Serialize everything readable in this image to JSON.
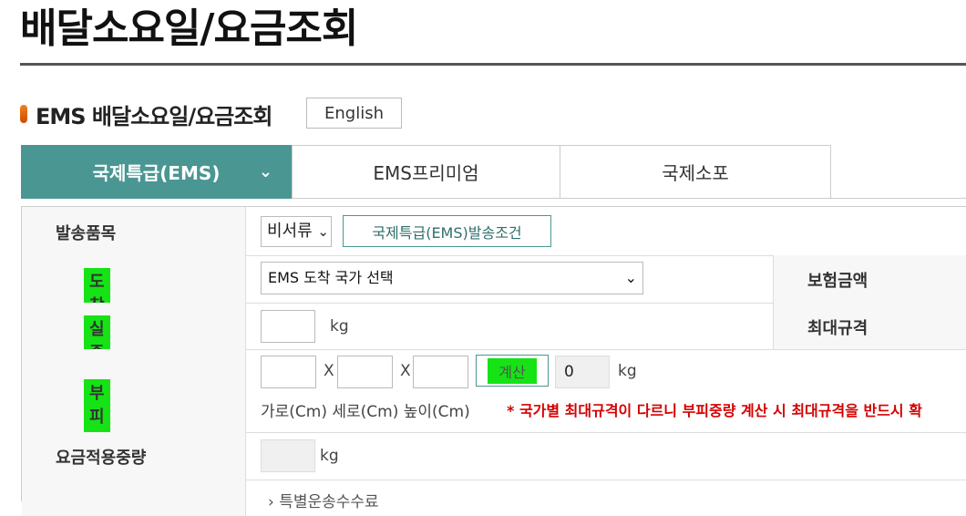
{
  "page": {
    "title": "배달소요일/요금조회"
  },
  "section": {
    "title": "EMS 배달소요일/요금조회",
    "english_button": "English"
  },
  "tabs": [
    {
      "label": "국제특급(EMS)",
      "active": true
    },
    {
      "label": "EMS프리미엄",
      "active": false
    },
    {
      "label": "국제소포",
      "active": false
    }
  ],
  "form": {
    "item_type": {
      "label": "발송품목",
      "selected": "비서류",
      "condition_button": "국제특급(EMS)발송조건"
    },
    "destination": {
      "label": "도착지",
      "selected": "EMS 도착 국가 선택"
    },
    "insurance": {
      "label": "보험금액"
    },
    "actual_weight": {
      "label": "실중량",
      "value": "",
      "unit": "kg"
    },
    "max_size": {
      "label": "최대규격"
    },
    "volume_weight": {
      "label": "부피중량",
      "width": "",
      "depth": "",
      "height": "",
      "separator": "X",
      "calc_button": "계산",
      "result": "0",
      "unit": "kg",
      "dims_text": "가로(Cm) 세로(Cm) 높이(Cm)",
      "warning": "* 국가별 최대규격이 다르니 부피중량 계산 시 최대규격을 반드시 확"
    },
    "charged_weight": {
      "label": "요금적용중량",
      "value": "",
      "unit": "kg"
    },
    "special_handling": {
      "text": "› 특별운송수수료"
    }
  },
  "colors": {
    "teal": "#4a9693",
    "highlight": "#16e316",
    "warning": "#d40000",
    "orange": "#e86a10"
  }
}
